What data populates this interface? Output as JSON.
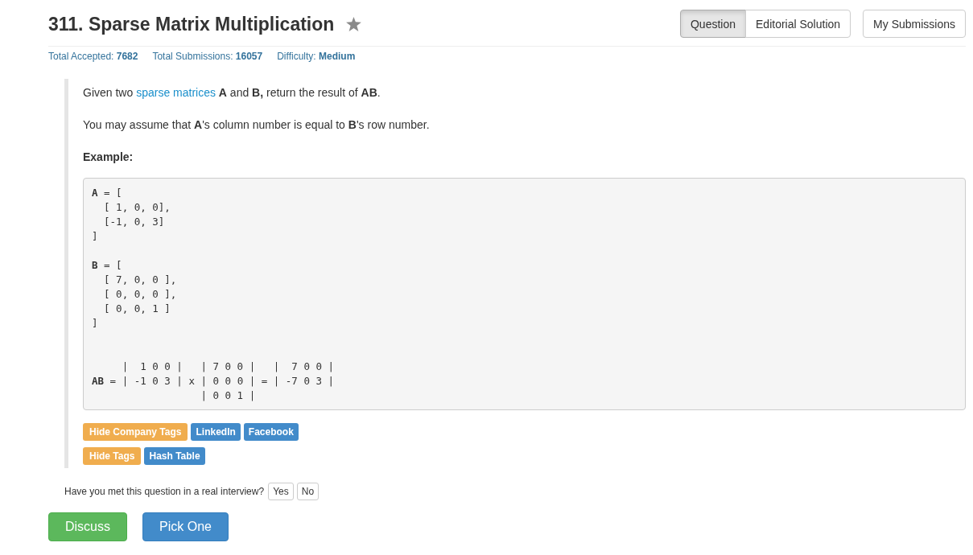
{
  "problem": {
    "title": "311. Sparse Matrix Multiplication",
    "starred": false
  },
  "view_tabs": [
    {
      "label": "Question",
      "selected": true
    },
    {
      "label": "Editorial Solution",
      "selected": false
    }
  ],
  "submissions_button": "My Submissions",
  "stats": [
    {
      "label": "Total Accepted:",
      "value": "7682"
    },
    {
      "label": "Total Submissions:",
      "value": "16057"
    },
    {
      "label": "Difficulty:",
      "value": "Medium"
    }
  ],
  "description": {
    "paragraphs": [
      {
        "parts": [
          {
            "kind": "text",
            "text": "Given two "
          },
          {
            "kind": "link",
            "text": "sparse matrices"
          },
          {
            "kind": "text",
            "text": " **A** and **B,** return the result of **AB**."
          }
        ]
      },
      {
        "parts": [
          {
            "kind": "text",
            "text": "You may assume that **A**'s column number is equal to **B**'s row number."
          }
        ]
      }
    ],
    "example_heading": "Example:",
    "example_code": "**A** = [\n  [ 1, 0, 0],\n  [-1, 0, 3]\n]\n\n**B** = [\n  [ 7, 0, 0 ],\n  [ 0, 0, 0 ],\n  [ 0, 0, 1 ]\n]\n\n\n     |  1 0 0 |   | 7 0 0 |   |  7 0 0 |\n**AB** = | -1 0 3 | x | 0 0 0 | = | -7 0 3 |\n                  | 0 0 1 |"
  },
  "tag_groups": [
    {
      "toggle": "Hide Company Tags",
      "tags": [
        "LinkedIn",
        "Facebook"
      ]
    },
    {
      "toggle": "Hide Tags",
      "tags": [
        "Hash Table"
      ]
    }
  ],
  "interview_prompt": {
    "question": "Have you met this question in a real interview?",
    "answers": [
      "Yes",
      "No"
    ]
  },
  "actions": [
    {
      "label": "Discuss",
      "kind": "success"
    },
    {
      "label": "Pick One",
      "kind": "primary"
    }
  ]
}
